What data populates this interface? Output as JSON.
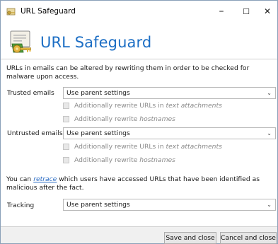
{
  "window": {
    "title": "URL Safeguard",
    "controls": {
      "minimize": "–",
      "maximize": "☐",
      "close": "✕"
    }
  },
  "header": {
    "title": "URL Safeguard"
  },
  "description": "URLs in emails can be altered by rewriting them in order to be checked for malware upon access.",
  "trusted": {
    "label": "Trusted emails",
    "select": "Use parent settings",
    "opt1_prefix": "Additionally rewrite URLs in ",
    "opt1_em": "text attachments",
    "opt2_prefix": "Additionally rewrite ",
    "opt2_em": "hostnames"
  },
  "untrusted": {
    "label": "Untrusted emails",
    "select": "Use parent settings",
    "opt1_prefix": "Additionally rewrite URLs in ",
    "opt1_em": "text attachments",
    "opt2_prefix": "Additionally rewrite ",
    "opt2_em": "hostnames"
  },
  "retrace_text": {
    "before": "You can ",
    "link": "retrace",
    "after": " which users have accessed URLs that have been identified as malicious after the fact."
  },
  "tracking": {
    "label": "Tracking",
    "select": "Use parent settings"
  },
  "buttons": {
    "save": "Save and close",
    "cancel": "Cancel and close"
  },
  "colors": {
    "accent": "#1c6ec4",
    "link": "#2b6cc4"
  },
  "icons": {
    "title_icon": "key-certificate-icon",
    "header_icon": "key-certificate-icon",
    "select_arrow": "chevron-down-icon"
  }
}
